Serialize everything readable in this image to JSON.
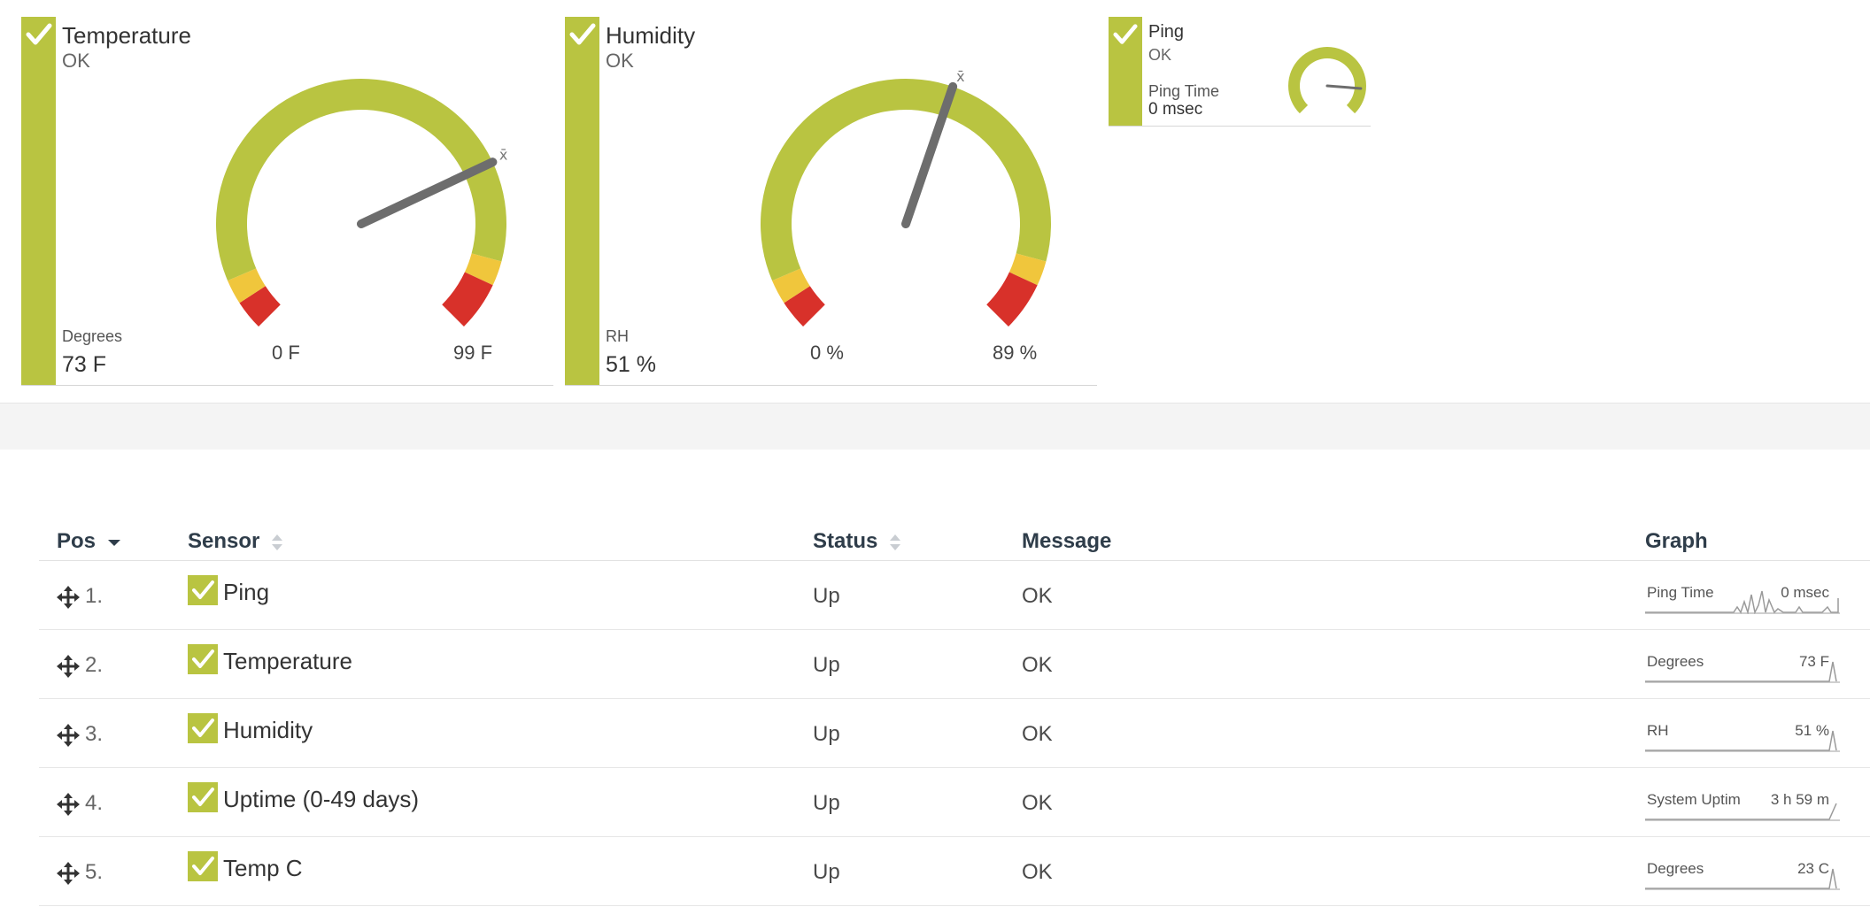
{
  "gauges": [
    {
      "title": "Temperature",
      "status": "OK",
      "channel_label": "Degrees",
      "channel_value": "73 F",
      "min_label": "0 F",
      "max_label": "99 F",
      "avg_marker": "x̄",
      "needle_fraction": 0.74
    },
    {
      "title": "Humidity",
      "status": "OK",
      "channel_label": "RH",
      "channel_value": "51 %",
      "min_label": "0 %",
      "max_label": "89 %",
      "avg_marker": "x̄",
      "needle_fraction": 0.57
    },
    {
      "title": "Ping",
      "status": "OK",
      "channel_label": "Ping Time",
      "channel_value": "0 msec",
      "needle_fraction": 0.85
    }
  ],
  "colors": {
    "ok_green": "#b9c441",
    "warning_yellow": "#f0c63c",
    "error_red": "#d8312a",
    "needle_gray": "#6d6d6d"
  },
  "table": {
    "headers": {
      "pos": "Pos",
      "sensor": "Sensor",
      "status": "Status",
      "message": "Message",
      "graph": "Graph"
    },
    "rows": [
      {
        "pos": "1.",
        "sensor": "Ping",
        "status": "Up",
        "message": "OK",
        "graph_label": "Ping Time",
        "graph_value": "0 msec"
      },
      {
        "pos": "2.",
        "sensor": "Temperature",
        "status": "Up",
        "message": "OK",
        "graph_label": "Degrees",
        "graph_value": "73 F"
      },
      {
        "pos": "3.",
        "sensor": "Humidity",
        "status": "Up",
        "message": "OK",
        "graph_label": "RH",
        "graph_value": "51 %"
      },
      {
        "pos": "4.",
        "sensor": "Uptime (0-49 days)",
        "status": "Up",
        "message": "OK",
        "graph_label": "System Uptim",
        "graph_value": "3 h 59 m"
      },
      {
        "pos": "5.",
        "sensor": "Temp C",
        "status": "Up",
        "message": "OK",
        "graph_label": "Degrees",
        "graph_value": "23 C"
      }
    ]
  }
}
